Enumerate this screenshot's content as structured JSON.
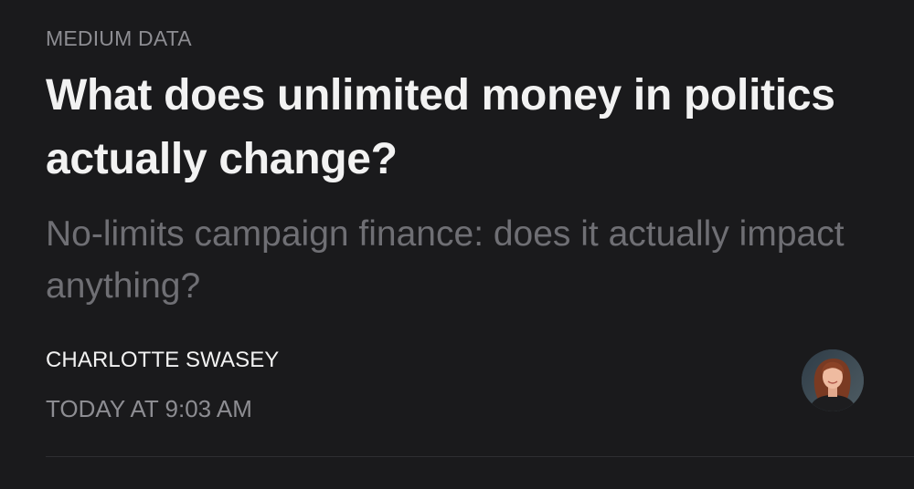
{
  "article": {
    "publication": "MEDIUM DATA",
    "title": "What does unlimited money in politics actually change?",
    "subtitle": "No-limits campaign finance: does it actually impact anything?",
    "author": "CHARLOTTE SWASEY",
    "timestamp": "TODAY AT 9:03 AM",
    "avatar_icon": "author-photo-avatar"
  },
  "colors": {
    "background": "#1a1a1c",
    "title": "#f2f2f2",
    "subtitle": "#6f6f74",
    "meta": "#8d8d92"
  }
}
